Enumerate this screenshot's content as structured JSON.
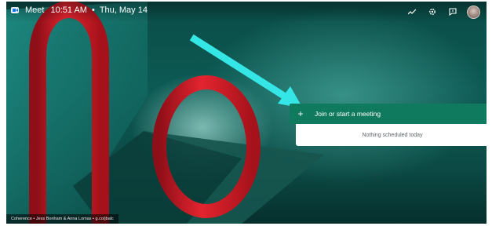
{
  "header": {
    "app_name": "Meet",
    "time": "10:51 AM",
    "separator": "•",
    "date": "Thu, May 14",
    "icons": [
      "activity-icon",
      "gear-icon",
      "feedback-icon",
      "avatar"
    ]
  },
  "meeting_panel": {
    "join_icon": "+",
    "join_label": "Join or start a meeting",
    "schedule_text": "Nothing scheduled today"
  },
  "footer": {
    "credit": "Coherence • Jess Bonham & Anna Lomax • g.co/jbalc"
  },
  "colors": {
    "background": "#0b4a45",
    "join_button": "#0f7a5d",
    "arrow": "#35e6e6",
    "sculpture": "#d81e2a"
  }
}
